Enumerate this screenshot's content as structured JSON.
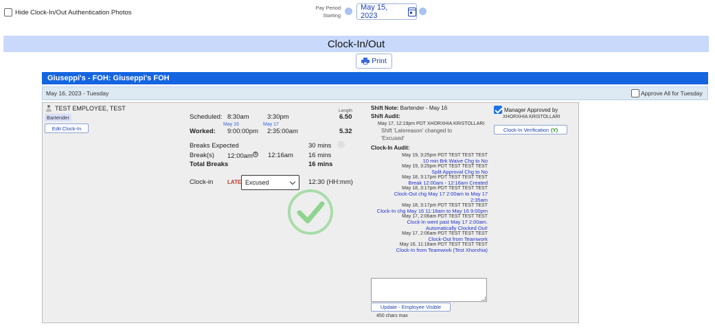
{
  "top": {
    "hide_photos_label": "Hide Clock-In/Out Authentication Photos",
    "pay_period_label_1": "Pay Period",
    "pay_period_label_2": "Starting",
    "pay_period_date": "May 15, 2023"
  },
  "page_title": "Clock-In/Out",
  "print_label": "Print",
  "location_title": "Giuseppi's - FOH: Giuseppi's FOH",
  "day": {
    "label": "May 16, 2023 - Tuesday",
    "approve_all_label": "Approve All for Tuesday"
  },
  "employee": {
    "name": "TEST EMPLOYEE, TEST",
    "role": "Bartender",
    "edit_button": "Edit Clock-In"
  },
  "shift": {
    "length_label": "Length",
    "scheduled_label": "Scheduled:",
    "scheduled_start": "8:30am",
    "scheduled_end": "3:30pm",
    "scheduled_length": "6.50",
    "worked_label": "Worked:",
    "worked_start_date": "May 16",
    "worked_end_date": "May 17",
    "worked_start": "9:00:00pm",
    "worked_end": "2:35:00am",
    "worked_length": "5.32",
    "breaks_expected_label": "Breaks Expected",
    "breaks_expected_value": "30 mins",
    "breaks_label": "Break(s)",
    "break_start": "12:00am",
    "break_end": "12:16am",
    "break_length": "16 mins",
    "total_breaks_label": "Total Breaks",
    "total_breaks_value": "16 mins",
    "clockin_label": "Clock-in",
    "late_label": "LATE",
    "reason_selected": "Excused",
    "late_duration": "12:30 (HH:mm)"
  },
  "notes": {
    "shift_note_label": "Shift Note:",
    "shift_note_value": "Bartender - May 16",
    "shift_audit_label": "Shift Audit:",
    "shift_audit_meta": "May 17, 12:19pm PDT XHORXHIA KRISTOLLARI",
    "shift_audit_text_1": "Shift 'Latereason' changed to",
    "shift_audit_text_2": "'Excused'",
    "clockin_audit_label": "Clock-In Audit:",
    "audit_entries": [
      {
        "meta": "May 19, 3:25pm PDT TEST TEST TEST",
        "text": [
          "10 min Brk Waive Chg to No"
        ]
      },
      {
        "meta": "May 19, 3:25pm PDT TEST TEST TEST",
        "text": [
          "Split Approval Chg to No"
        ]
      },
      {
        "meta": "May 18, 3:17pm PDT TEST TEST TEST",
        "text": [
          "Break 12:00am - 12:16am Created"
        ]
      },
      {
        "meta": "May 18, 3:17pm PDT TEST TEST TEST",
        "text": [
          "Clock-Out chg May 17 2:00am to May 17",
          "2:35am"
        ]
      },
      {
        "meta": "May 18, 3:17pm PDT TEST TEST TEST",
        "text": [
          "Clock-In chg May 16 11:18am to May 16 9:00pm"
        ]
      },
      {
        "meta": "May 17, 2:06am PDT TEST TEST TEST",
        "text": [
          "Clock-In went past May 17 2:00am.",
          "Automatically Clocked Out!"
        ]
      },
      {
        "meta": "May 17, 2:06am PDT TEST TEST TEST",
        "text": [
          "Clock-Out from Teamwork"
        ]
      },
      {
        "meta": "May 16, 11:18am PDT TEST TEST TEST",
        "text": [
          "Clock-In from Teamwork (Test Xhorxhia)"
        ]
      }
    ],
    "update_button": "Update - Employee Visible",
    "chars_max": "450 chars max"
  },
  "approval": {
    "manager_approved_label": "Manager Approved by",
    "manager_name": "XHORXHIA KRISTOLLARI",
    "verification_button": "Clock-In Verification",
    "verification_status": "(Y)"
  },
  "colors": {
    "primary": "#1565e0",
    "check_green": "#7ed07e",
    "late_red": "#c0392b"
  }
}
